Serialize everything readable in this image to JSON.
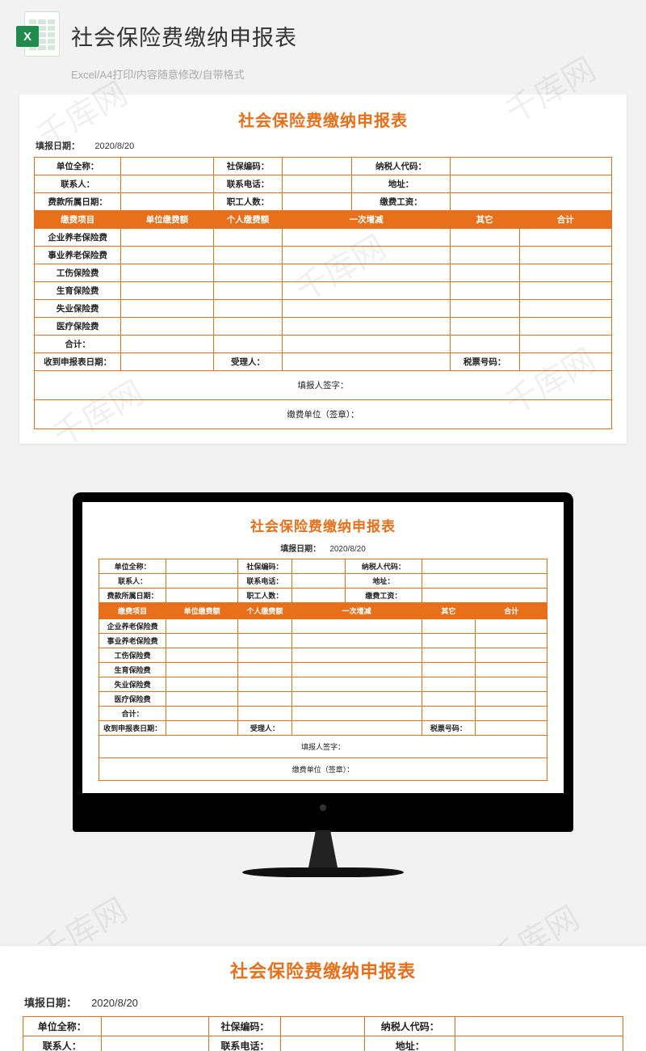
{
  "header": {
    "title": "社会保险费缴纳申报表",
    "subtitle": "Excel/A4打印/内容随意修改/自带格式",
    "excel_badge": "X"
  },
  "form": {
    "title": "社会保险费缴纳申报表",
    "meta": {
      "fill_date_label": "填报日期：",
      "fill_date_value": "2020/8/20"
    },
    "info_rows": [
      [
        {
          "label": "单位全称：",
          "value": ""
        },
        {
          "label": "社保编码：",
          "value": ""
        },
        {
          "label": "纳税人代码：",
          "value": ""
        }
      ],
      [
        {
          "label": "联系人：",
          "value": ""
        },
        {
          "label": "联系电话：",
          "value": ""
        },
        {
          "label": "地址：",
          "value": ""
        }
      ],
      [
        {
          "label": "费款所属日期：",
          "value": ""
        },
        {
          "label": "职工人数：",
          "value": ""
        },
        {
          "label": "缴费工资：",
          "value": ""
        }
      ]
    ],
    "columns": [
      "缴费项目",
      "单位缴费额",
      "个人缴费额",
      "一次增减",
      "其它",
      "合计"
    ],
    "items": [
      "企业养老保险费",
      "事业养老保险费",
      "工伤保险费",
      "生育保险费",
      "失业保险费",
      "医疗保险费",
      "合计："
    ],
    "footer_row": {
      "receive_date_label": "收到申报表日期：",
      "accepter_label": "受理人：",
      "tax_no_label": "税票号码："
    },
    "sign": {
      "filler": "填报人签字：",
      "unit_seal": "缴费单位（签章）："
    }
  },
  "watermark_text": "千库网"
}
